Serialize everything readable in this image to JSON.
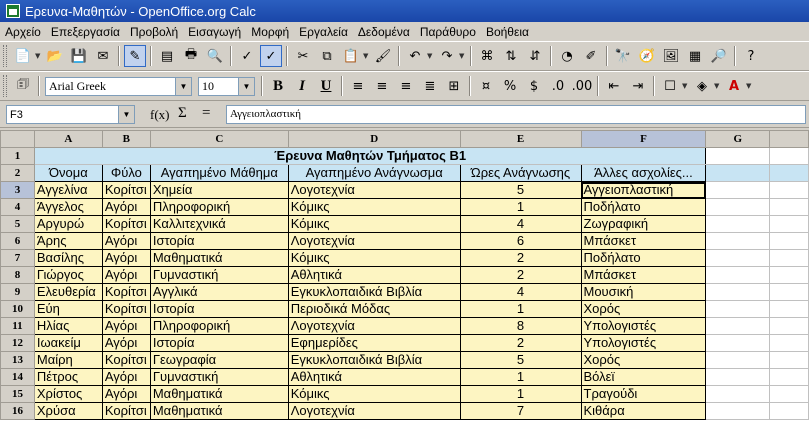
{
  "window": {
    "title": "Ερευνα-Μαθητών - OpenOffice.org Calc"
  },
  "menu": [
    "Αρχείο",
    "Επεξεργασία",
    "Προβολή",
    "Εισαγωγή",
    "Μορφή",
    "Εργαλεία",
    "Δεδομένα",
    "Παράθυρο",
    "Βοήθεια"
  ],
  "format_toolbar": {
    "font_name": "Arial Greek",
    "font_size": "10"
  },
  "formula_bar": {
    "cell_ref": "F3",
    "fx": "f(x)",
    "sum": "Σ",
    "equals": "=",
    "content": "Αγγειοπλαστική"
  },
  "sheet": {
    "columns": [
      "A",
      "B",
      "C",
      "D",
      "E",
      "F",
      "G"
    ],
    "title": "Έρευνα Μαθητών Τμήματος Β1",
    "headers": [
      "Όνομα",
      "Φύλο",
      "Αγαπημένο Μάθημα",
      "Αγαπημένο Ανάγνωσμα",
      "Ώρες Ανάγνωσης",
      "Άλλες ασχολίες..."
    ],
    "rows": [
      [
        "Αγγελίνα",
        "Κορίτσι",
        "Χημεία",
        "Λογοτεχνία",
        "5",
        "Αγγειοπλαστική"
      ],
      [
        "Άγγελος",
        "Αγόρι",
        "Πληροφορική",
        "Κόμικς",
        "1",
        "Ποδήλατο"
      ],
      [
        "Αργυρώ",
        "Κορίτσι",
        "Καλλιτεχνικά",
        "Κόμικς",
        "4",
        "Ζωγραφική"
      ],
      [
        "Άρης",
        "Αγόρι",
        "Ιστορία",
        "Λογοτεχνία",
        "6",
        "Μπάσκετ"
      ],
      [
        "Βασίλης",
        "Αγόρι",
        "Μαθηματικά",
        "Κόμικς",
        "2",
        "Ποδήλατο"
      ],
      [
        "Γιώργος",
        "Αγόρι",
        "Γυμναστική",
        "Αθλητικά",
        "2",
        "Μπάσκετ"
      ],
      [
        "Ελευθερία",
        "Κορίτσι",
        "Αγγλικά",
        "Εγκυκλοπαιδικά Βιβλία",
        "4",
        "Μουσική"
      ],
      [
        "Εύη",
        "Κορίτσι",
        "Ιστορία",
        "Περιοδικά Μόδας",
        "1",
        "Χορός"
      ],
      [
        "Ηλίας",
        "Αγόρι",
        "Πληροφορική",
        "Λογοτεχνία",
        "8",
        "Υπολογιστές"
      ],
      [
        "Ιωακείμ",
        "Αγόρι",
        "Ιστορία",
        "Εφημερίδες",
        "2",
        "Υπολογιστές"
      ],
      [
        "Μαίρη",
        "Κορίτσι",
        "Γεωγραφία",
        "Εγκυκλοπαιδικά Βιβλία",
        "5",
        "Χορός"
      ],
      [
        "Πέτρος",
        "Αγόρι",
        "Γυμναστική",
        "Αθλητικά",
        "1",
        "Βόλεϊ"
      ],
      [
        "Χρίστος",
        "Αγόρι",
        "Μαθηματικά",
        "Κόμικς",
        "1",
        "Τραγούδι"
      ],
      [
        "Χρύσα",
        "Κορίτσι",
        "Μαθηματικά",
        "Λογοτεχνία",
        "7",
        "Κιθάρα"
      ]
    ]
  },
  "colors": {
    "title_bar": "#1a46a8",
    "header_fill": "#c8e4f3",
    "data_fill": "#fdf5c2"
  }
}
